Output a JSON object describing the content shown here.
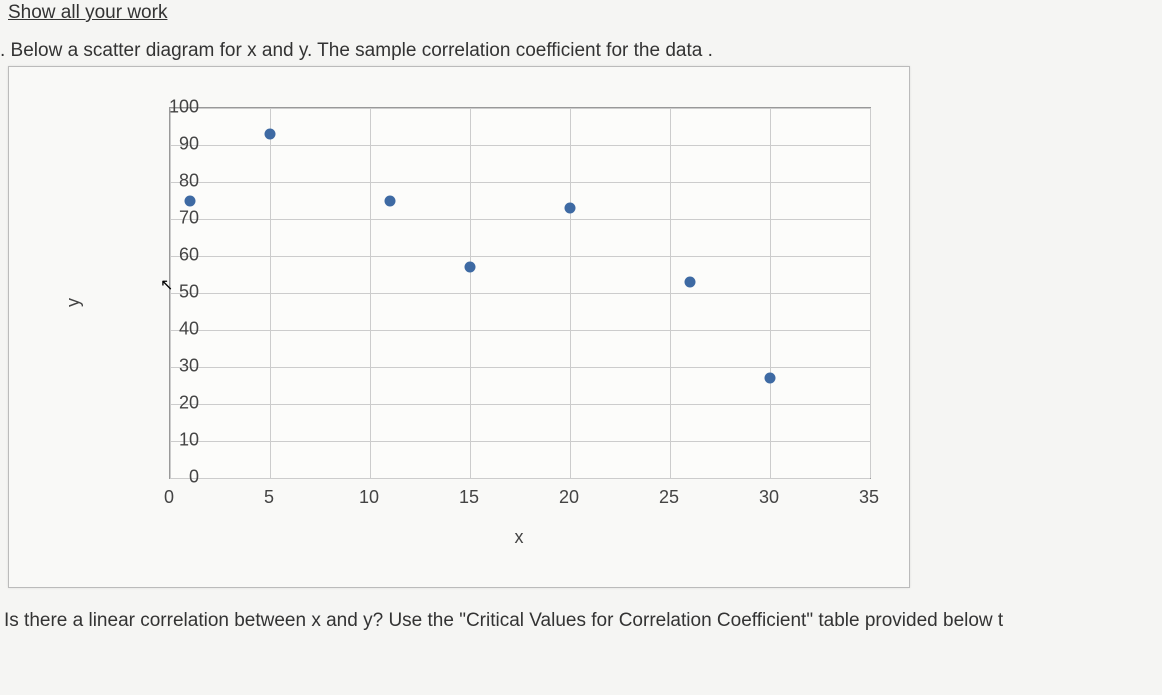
{
  "header_instruction": "Show all your work",
  "description": ". Below a scatter diagram for x and y. The sample correlation coefficient for the data .",
  "chart_data": {
    "type": "scatter",
    "xlabel": "x",
    "ylabel": "y",
    "xlim": [
      0,
      35
    ],
    "ylim": [
      0,
      100
    ],
    "xticks": [
      0,
      5,
      10,
      15,
      20,
      25,
      30,
      35
    ],
    "yticks": [
      0,
      10,
      20,
      30,
      40,
      50,
      60,
      70,
      80,
      90,
      100
    ],
    "points": [
      {
        "x": 1,
        "y": 75
      },
      {
        "x": 5,
        "y": 93
      },
      {
        "x": 11,
        "y": 75
      },
      {
        "x": 15,
        "y": 57
      },
      {
        "x": 20,
        "y": 73
      },
      {
        "x": 26,
        "y": 53
      },
      {
        "x": 30,
        "y": 27
      }
    ]
  },
  "question": "Is there a linear correlation between x and y? Use the \"Critical Values for Correlation Coefficient\" table provided below t"
}
